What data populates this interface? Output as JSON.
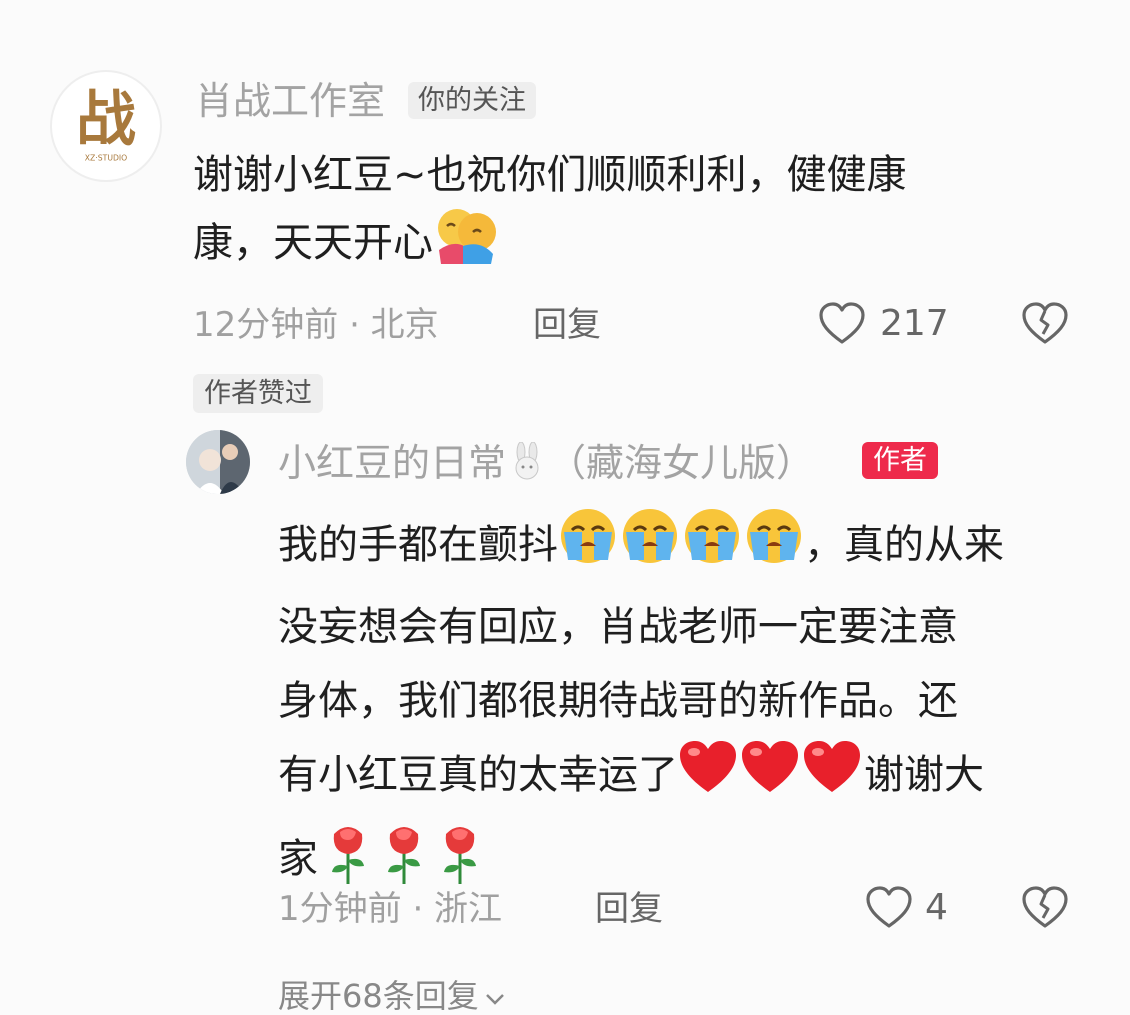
{
  "main_comment": {
    "avatar_glyph": "战",
    "avatar_sub": "XZ·STUDIO",
    "author": "肖战工作室",
    "follow_tag": "你的关注",
    "line1": "谢谢小红豆~也祝你们顺顺利利，健健康",
    "line2": "康，天天开心",
    "time_location": "12分钟前 · 北京",
    "reply_label": "回复",
    "likes": "217"
  },
  "author_liked_tag": "作者赞过",
  "reply_comment": {
    "author": "小红豆的日常",
    "author_suffix": "（藏海女儿版）",
    "author_tag": "作者",
    "line1a": "我的手都在颤抖",
    "line1b": "，真的从来",
    "line2": "没妄想会有回应，肖战老师一定要注意",
    "line3": "身体，我们都很期待战哥的新作品。还",
    "line4a": "有小红豆真的太幸运了",
    "line4b": "谢谢大",
    "line5": "家",
    "time_location": "1分钟前 · 浙江",
    "reply_label": "回复",
    "likes": "4"
  },
  "expand_replies": "展开68条回复",
  "colors": {
    "author_tag": "#ee2a4b",
    "avatar_gold": "#a8793c",
    "meta_grey": "#a0a0a0"
  },
  "icons": [
    "heart-outline-icon",
    "broken-heart-icon",
    "hug-emoji",
    "crying-emoji",
    "red-heart-emoji",
    "rose-emoji",
    "rabbit-emoji",
    "chevron-down-icon"
  ]
}
